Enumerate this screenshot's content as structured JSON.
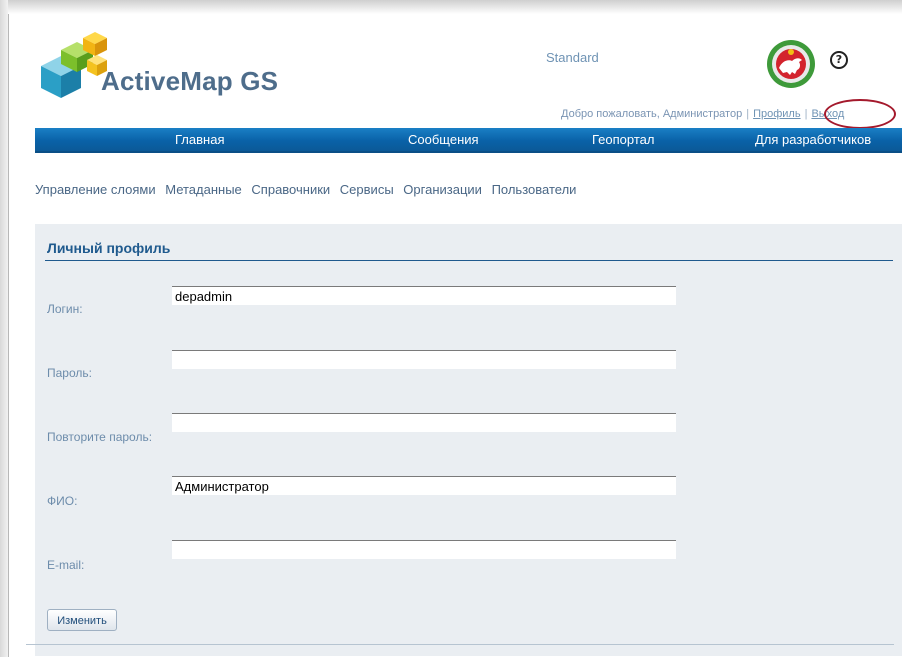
{
  "header": {
    "brand": "ActiveMap GS",
    "edition": "Standard",
    "help_glyph": "?",
    "welcome": "Добро пожаловать, Администратор",
    "profile_link": "Профиль",
    "logout_link": "Выход",
    "separator": "|"
  },
  "main_nav": [
    "Главная",
    "Сообщения",
    "Геопортал",
    "Для разработчиков"
  ],
  "sub_nav": [
    "Управление слоями",
    "Метаданные",
    "Справочники",
    "Сервисы",
    "Организации",
    "Пользователи"
  ],
  "profile": {
    "title": "Личный профиль",
    "fields": [
      {
        "label": "Логин:",
        "value": "depadmin"
      },
      {
        "label": "Пароль:",
        "value": ""
      },
      {
        "label": "Повторите пароль:",
        "value": ""
      },
      {
        "label": "ФИО:",
        "value": "Администратор"
      },
      {
        "label": "E-mail:",
        "value": ""
      }
    ],
    "submit_label": "Изменить"
  },
  "icons": {
    "logo": "activemap-cube-logo-icon",
    "emblem": "tatarstan-emblem-icon",
    "help": "help-icon"
  },
  "colors": {
    "nav_blue": "#0a62a8",
    "heading_blue": "#1f5a8e",
    "panel_bg": "#eaeef2",
    "highlight_ring": "#a4192c"
  }
}
